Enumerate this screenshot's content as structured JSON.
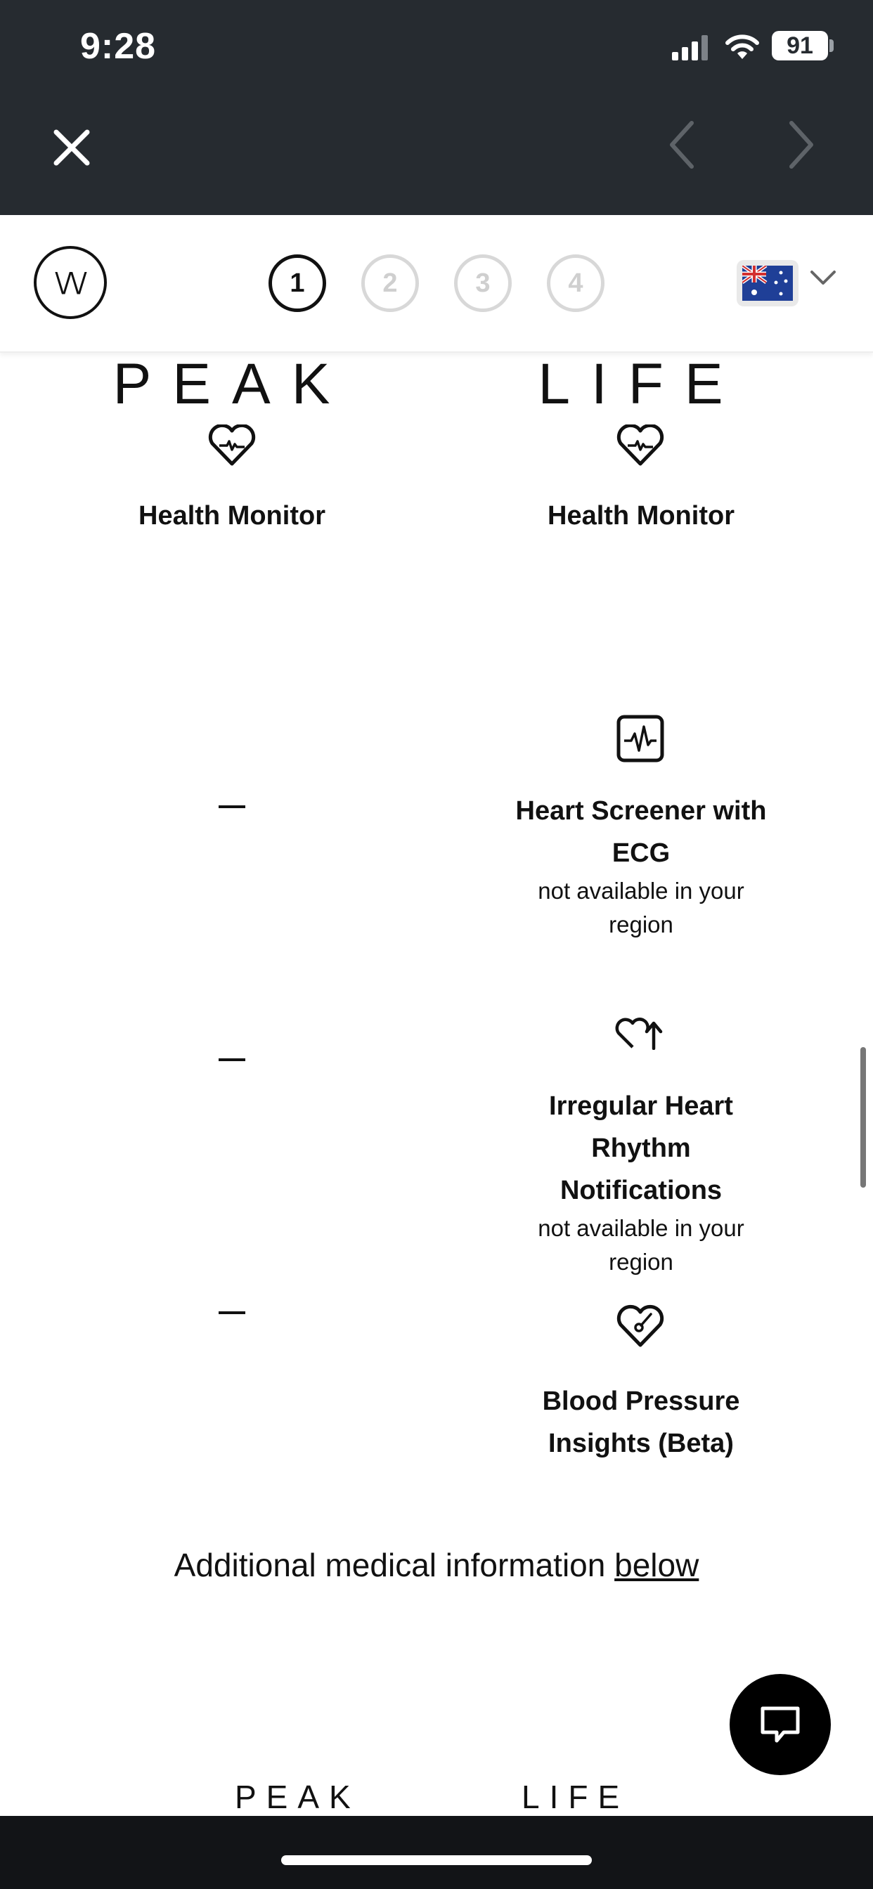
{
  "status_bar": {
    "time": "9:28",
    "battery": "91"
  },
  "browser_bar": {
    "close_icon": "close-icon",
    "back_icon": "chevron-left-icon",
    "forward_icon": "chevron-right-icon"
  },
  "header": {
    "logo_text": "\\/\\/",
    "steps": [
      {
        "label": "1",
        "active": true
      },
      {
        "label": "2",
        "active": false
      },
      {
        "label": "3",
        "active": false
      },
      {
        "label": "4",
        "active": false
      }
    ],
    "region_flag": "australia-flag-icon"
  },
  "products": {
    "left": {
      "name": "PEAK"
    },
    "right": {
      "name": "LIFE"
    }
  },
  "features": [
    {
      "icon": "heart-pulse-icon",
      "left_value": null,
      "left_icon": "heart-pulse-icon",
      "left_title": "Health Monitor",
      "right_title": "Health Monitor"
    },
    {
      "icon": "ecg-icon",
      "left_value": "–",
      "right_title": "Heart Screener with ECG",
      "right_subtitle": "not available in your region"
    },
    {
      "icon": "heart-rhythm-icon",
      "left_value": "–",
      "right_title": "Irregular Heart Rhythm Notifications",
      "right_subtitle": "not available in your region"
    },
    {
      "icon": "blood-pressure-icon",
      "left_value": "–",
      "right_title": "Blood Pressure Insights (Beta)"
    }
  ],
  "additional_info": {
    "text": "Additional medical information ",
    "link": "below"
  },
  "bottom_products": {
    "left": "PEAK",
    "right": "LIFE"
  },
  "chat_icon": "chat-bubble-icon"
}
